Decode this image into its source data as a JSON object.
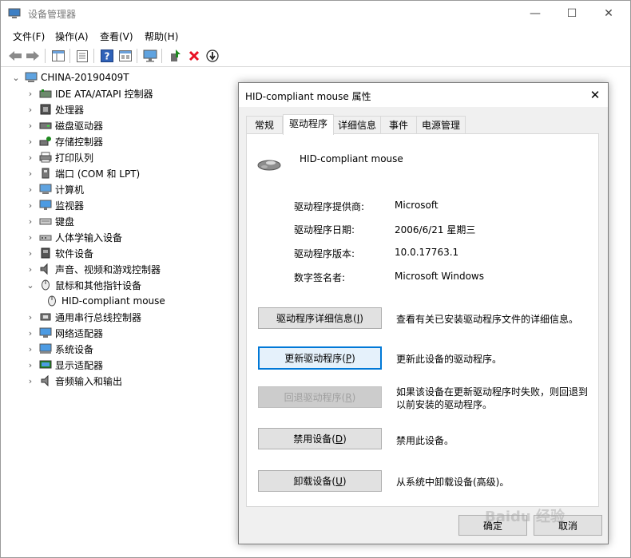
{
  "window": {
    "title": "设备管理器",
    "minimize_glyph": "—",
    "maximize_glyph": "☐",
    "close_glyph": "✕"
  },
  "menu": [
    {
      "label": "文件(F)"
    },
    {
      "label": "操作(A)"
    },
    {
      "label": "查看(V)"
    },
    {
      "label": "帮助(H)"
    }
  ],
  "toolbar": {
    "icons": [
      "back-arrow-icon",
      "forward-arrow-icon",
      "properties-icon",
      "console-tree-icon",
      "help-icon",
      "view-icon",
      "monitor-icon",
      "update-driver-icon",
      "uninstall-icon",
      "scan-hardware-icon"
    ]
  },
  "tree": {
    "root": "CHINA-20190409T",
    "items": [
      {
        "label": "IDE ATA/ATAPI 控制器",
        "icon": "ide-controller-icon"
      },
      {
        "label": "处理器",
        "icon": "processor-icon"
      },
      {
        "label": "磁盘驱动器",
        "icon": "disk-drive-icon"
      },
      {
        "label": "存储控制器",
        "icon": "storage-controller-icon"
      },
      {
        "label": "打印队列",
        "icon": "printer-icon"
      },
      {
        "label": "端口 (COM 和 LPT)",
        "icon": "port-icon"
      },
      {
        "label": "计算机",
        "icon": "computer-icon"
      },
      {
        "label": "监视器",
        "icon": "monitor-icon"
      },
      {
        "label": "键盘",
        "icon": "keyboard-icon"
      },
      {
        "label": "人体学输入设备",
        "icon": "hid-icon"
      },
      {
        "label": "软件设备",
        "icon": "software-device-icon"
      },
      {
        "label": "声音、视频和游戏控制器",
        "icon": "sound-icon"
      },
      {
        "label": "鼠标和其他指针设备",
        "icon": "mouse-icon",
        "expanded": true
      },
      {
        "label": "HID-compliant mouse",
        "icon": "mouse-icon",
        "child": true
      },
      {
        "label": "通用串行总线控制器",
        "icon": "usb-icon"
      },
      {
        "label": "网络适配器",
        "icon": "network-adapter-icon"
      },
      {
        "label": "系统设备",
        "icon": "system-device-icon"
      },
      {
        "label": "显示适配器",
        "icon": "display-adapter-icon"
      },
      {
        "label": "音频输入和输出",
        "icon": "audio-icon"
      }
    ]
  },
  "dialog": {
    "title": "HID-compliant mouse 属性",
    "tabs": [
      {
        "label": "常规"
      },
      {
        "label": "驱动程序",
        "active": true
      },
      {
        "label": "详细信息"
      },
      {
        "label": "事件"
      },
      {
        "label": "电源管理"
      }
    ],
    "device_name": "HID-compliant mouse",
    "props": [
      {
        "key": "驱动程序提供商:",
        "value": "Microsoft"
      },
      {
        "key": "驱动程序日期:",
        "value": "2006/6/21 星期三"
      },
      {
        "key": "驱动程序版本:",
        "value": "10.0.17763.1"
      },
      {
        "key": "数字签名者:",
        "value": "Microsoft Windows"
      }
    ],
    "actions": [
      {
        "button_pre": "驱动程序详细信息(",
        "button_key": "I",
        "button_post": ")",
        "desc": "查看有关已安装驱动程序文件的详细信息。"
      },
      {
        "button_pre": "更新驱动程序(",
        "button_key": "P",
        "button_post": ")",
        "desc": "更新此设备的驱动程序。"
      },
      {
        "button_pre": "回退驱动程序(",
        "button_key": "R",
        "button_post": ")",
        "desc": "如果该设备在更新驱动程序时失败，则回退到以前安装的驱动程序。"
      },
      {
        "button_pre": "禁用设备(",
        "button_key": "D",
        "button_post": ")",
        "desc": "禁用此设备。"
      },
      {
        "button_pre": "卸载设备(",
        "button_key": "U",
        "button_post": ")",
        "desc": "从系统中卸载设备(高级)。"
      }
    ],
    "ok_label": "确定",
    "cancel_label": "取消"
  },
  "watermark": "Baidu 经验",
  "colors": {
    "accent": "#0078d7",
    "delete_red": "#e81123",
    "update_green": "#1e8a1e"
  }
}
